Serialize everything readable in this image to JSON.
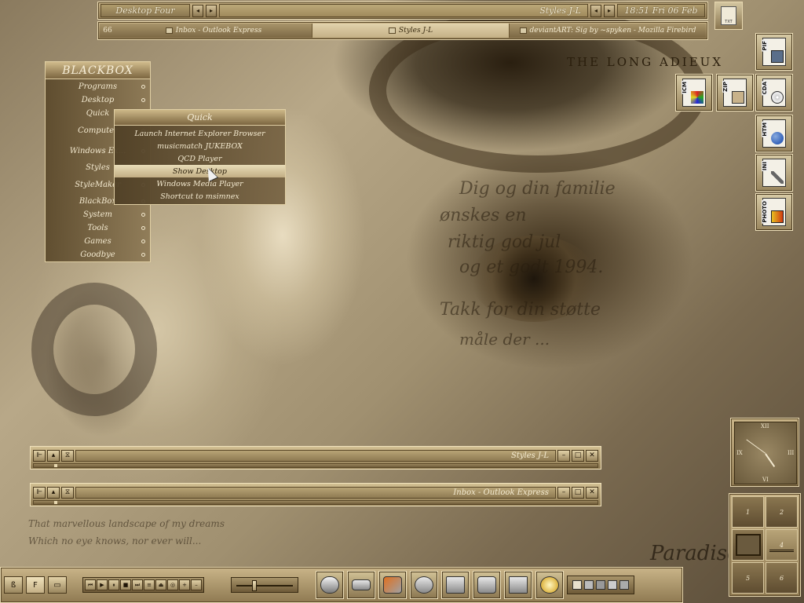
{
  "wallpaper": {
    "heading": "THE LONG ADIEUX",
    "script_lines": [
      "Dig og din familie",
      "ønskes en",
      "riktig god jul",
      "og et godt 1994.",
      "Takk for din støtte",
      "måle der ...",
      "...",
      "...",
      "...",
      "..."
    ],
    "poem": [
      "That marvellous landscape of my dreams",
      "Which no eye knows, nor ever will..."
    ],
    "signature": "Paradise"
  },
  "topbar": {
    "workspace": "Desktop Four",
    "window": "Styles J-L",
    "clock": "18:51 Fri 06 Feb"
  },
  "taskbar": {
    "count": "66",
    "tasks": [
      {
        "label": "Inbox - Outlook Express"
      },
      {
        "label": "Styles J-L"
      },
      {
        "label": "deviantART: Sig by ~spyken - Mozilla Firebird"
      }
    ]
  },
  "tray_icon": {
    "label": "TXT"
  },
  "blackbox": {
    "title": "BLACKBOX",
    "items": [
      "Programs",
      "Desktop",
      "Quick",
      "Computer",
      "Windows Ex...",
      "Styles",
      "StyleMaker",
      "BlackBox",
      "System",
      "Tools",
      "Games",
      "Goodbye"
    ]
  },
  "quick": {
    "title": "Quick",
    "items": [
      "Launch Internet Explorer Browser",
      "musicmatch JUKEBOX",
      "QCD Player",
      "Show Desktop",
      "Windows Media Player",
      "Shortcut to msimnex"
    ],
    "selected": "Show Desktop"
  },
  "desktop_icons": [
    {
      "ext": "PIF"
    },
    {
      "ext": "ICM"
    },
    {
      "ext": "ZIP"
    },
    {
      "ext": "CDA"
    },
    {
      "ext": "HTM"
    },
    {
      "ext": "INI"
    },
    {
      "ext": "PHOTO"
    }
  ],
  "clock": {
    "hours": 4,
    "minutes": 51
  },
  "clock_numerals": [
    "XII",
    "III",
    "VI",
    "IX"
  ],
  "pager": [
    "1",
    "2",
    "3",
    "4",
    "5",
    "6"
  ],
  "windows": [
    {
      "title": "Styles J-L"
    },
    {
      "title": "Inbox - Outlook Express"
    }
  ],
  "toolbar_bottom": {
    "media": [
      "⏮",
      "▶",
      "⏸",
      "■",
      "⏭",
      "≡",
      "⏏",
      "◎",
      "+",
      "–"
    ],
    "volume": 0.3
  },
  "colors": {
    "accent": "#c4b086",
    "frame": "#8f7a52",
    "text": "#f3e9cf"
  }
}
